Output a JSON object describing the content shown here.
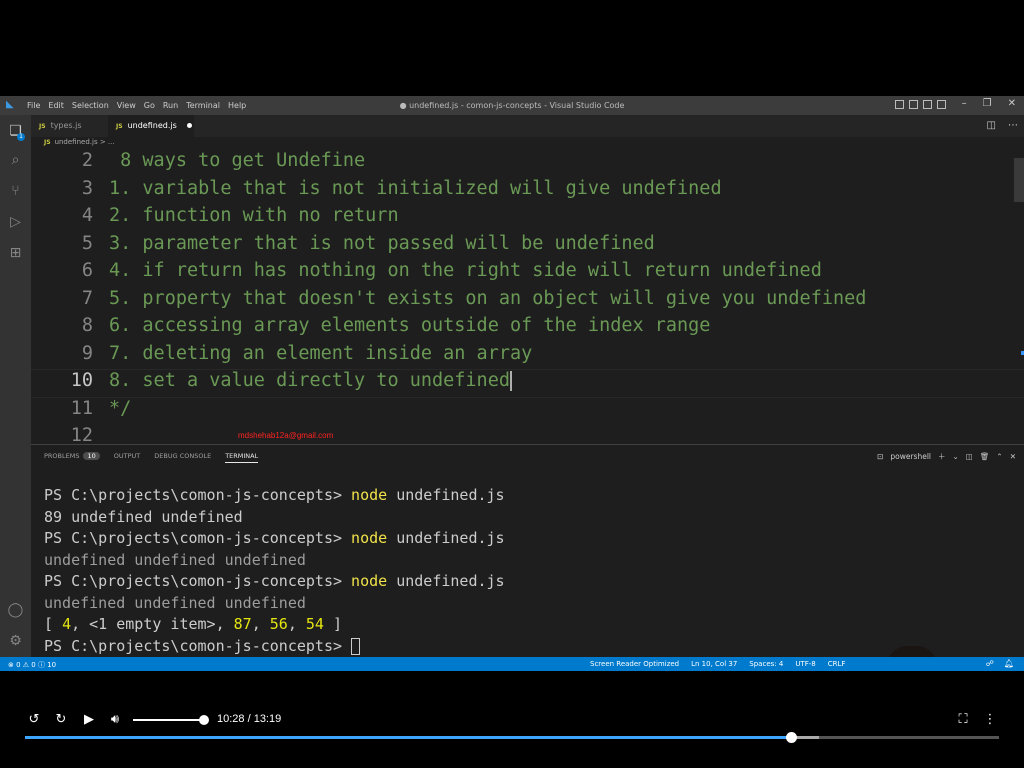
{
  "titlebar": {
    "menu": [
      "File",
      "Edit",
      "Selection",
      "View",
      "Go",
      "Run",
      "Terminal",
      "Help"
    ],
    "title": "● undefined.js - comon-js-concepts - Visual Studio Code"
  },
  "activity_badge": "1",
  "tabs": [
    {
      "icon": "JS",
      "label": "types.js"
    },
    {
      "icon": "JS",
      "label": "undefined.js"
    }
  ],
  "breadcrumb": {
    "icon": "JS",
    "file": "undefined.js",
    "rest": "> ..."
  },
  "editor": {
    "lines": [
      {
        "num": "2",
        "code": " 8 ways to get Undefine"
      },
      {
        "num": "3",
        "code": "1. variable that is not initialized will give undefined"
      },
      {
        "num": "4",
        "code": "2. function with no return"
      },
      {
        "num": "5",
        "code": "3. parameter that is not passed will be undefined"
      },
      {
        "num": "6",
        "code": "4. if return has nothing on the right side will return undefined"
      },
      {
        "num": "7",
        "code": "5. property that doesn't exists on an object will give you undefined"
      },
      {
        "num": "8",
        "code": "6. accessing array elements outside of the index range"
      },
      {
        "num": "9",
        "code": "7. deleting an element inside an array"
      },
      {
        "num": "10",
        "code": "8. set a value directly to undefined"
      },
      {
        "num": "11",
        "code": "*/"
      },
      {
        "num": "12",
        "code": ""
      }
    ],
    "watermark": "mdshehab12a@gmail.com"
  },
  "panel": {
    "tabs": {
      "problems": "PROBLEMS",
      "problems_count": "10",
      "output": "OUTPUT",
      "debug": "DEBUG CONSOLE",
      "terminal": "TERMINAL"
    },
    "shell": "powershell"
  },
  "terminal": {
    "prompt": "PS C:\\projects\\comon-js-concepts> ",
    "cmd": "node",
    "arg": " undefined.js",
    "out1": "89 undefined undefined",
    "out2": "undefined undefined undefined",
    "out3": "undefined undefined undefined",
    "out4_open": "[ ",
    "out4_a": "4",
    "out4_mid": ", <1 empty item>, ",
    "out4_b": "87",
    "out4_sep1": ", ",
    "out4_c": "56",
    "out4_sep2": ", ",
    "out4_d": "54",
    "out4_close": " ]"
  },
  "statusbar": {
    "problems": "⊗ 0 ⚠ 0 ⓘ 10",
    "screen_reader": "Screen Reader Optimized",
    "position": "Ln 10, Col 37",
    "spaces": "Spaces: 4",
    "encoding": "UTF-8",
    "eol": "CRLF"
  },
  "player": {
    "time": "10:28 / 13:19",
    "progress": 0.786,
    "buffered": 0.815
  },
  "colors": {
    "accent": "#007acc",
    "comment": "#6a9955",
    "progress": "#3ea6ff"
  }
}
